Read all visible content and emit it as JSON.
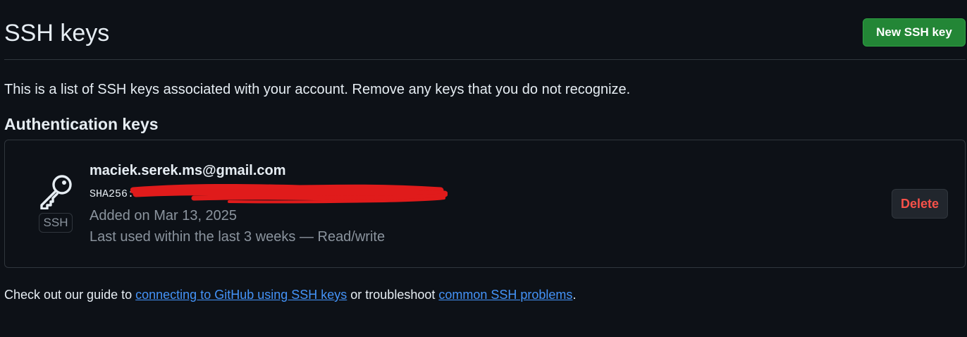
{
  "header": {
    "title": "SSH keys",
    "new_button_label": "New SSH key"
  },
  "intro_text": "This is a list of SSH keys associated with your account. Remove any keys that you do not recognize.",
  "section_title": "Authentication keys",
  "keys": [
    {
      "title": "maciek.serek.ms@gmail.com",
      "fingerprint": "SHA256:",
      "badge": "SSH",
      "added": "Added on Mar 13, 2025",
      "last_used": "Last used within the last 3 weeks — Read/write",
      "delete_label": "Delete"
    }
  ],
  "footer": {
    "prefix": "Check out our guide to ",
    "link1": "connecting to GitHub using SSH keys",
    "middle": " or troubleshoot ",
    "link2": "common SSH problems",
    "suffix": "."
  },
  "colors": {
    "background": "#0d1117",
    "primary_button": "#238636",
    "danger_text": "#f85149",
    "link": "#4493f8",
    "muted_text": "#8b949e",
    "border": "#30363d",
    "redaction": "#e01b1b"
  },
  "icons": {
    "key": "key-icon"
  }
}
